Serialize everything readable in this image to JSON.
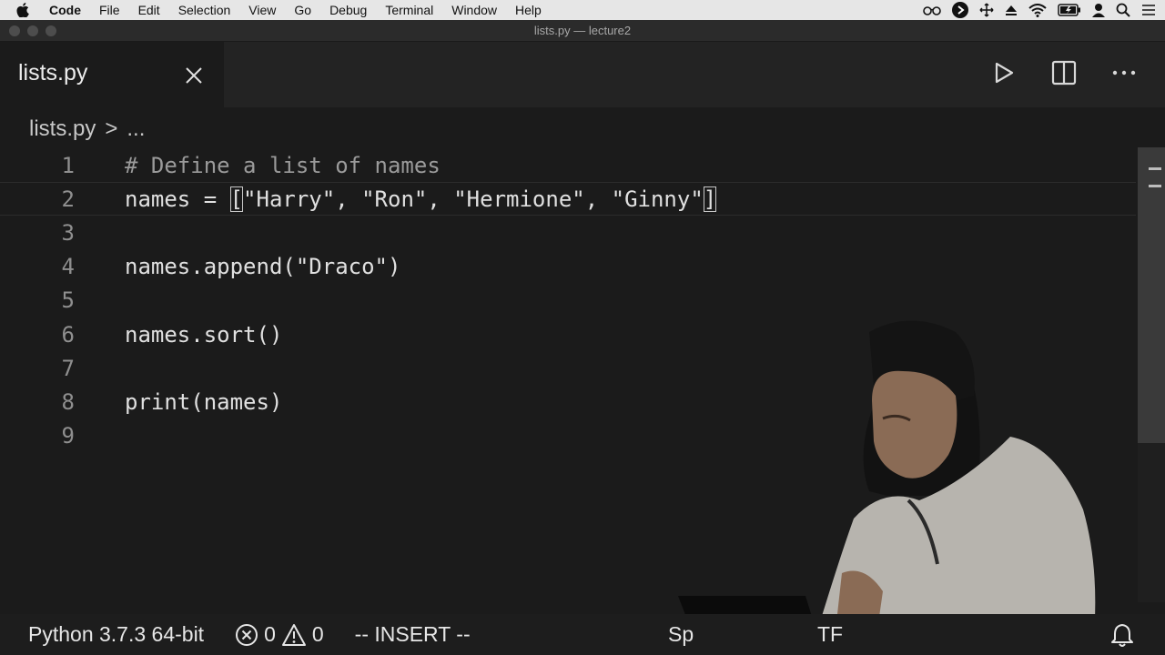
{
  "menubar": {
    "app_name": "Code",
    "items": [
      "File",
      "Edit",
      "Selection",
      "View",
      "Go",
      "Debug",
      "Terminal",
      "Window",
      "Help"
    ],
    "tray_icons": [
      "glasses-icon",
      "forward-circle-icon",
      "move-icon",
      "eject-icon",
      "wifi-icon",
      "battery-icon",
      "user-icon",
      "search-icon",
      "list-icon"
    ]
  },
  "window": {
    "title": "lists.py — lecture2"
  },
  "tab": {
    "label": "lists.py"
  },
  "breadcrumb": {
    "file": "lists.py",
    "separator": ">",
    "more": "..."
  },
  "editor": {
    "lines": [
      {
        "number": "1",
        "text": "# Define a list of names"
      },
      {
        "number": "2",
        "text": "names = ",
        "bracket_open": "[",
        "middle": "\"Harry\", \"Ron\", \"Hermione\", \"Ginny\"",
        "bracket_close": "]"
      },
      {
        "number": "3",
        "text": ""
      },
      {
        "number": "4",
        "text": "names.append(\"Draco\")"
      },
      {
        "number": "5",
        "text": ""
      },
      {
        "number": "6",
        "text": "names.sort()"
      },
      {
        "number": "7",
        "text": ""
      },
      {
        "number": "8",
        "text": "print(names)"
      },
      {
        "number": "9",
        "text": ""
      }
    ]
  },
  "statusbar": {
    "interpreter": "Python 3.7.3 64-bit",
    "errors": "0",
    "warnings": "0",
    "mode": "-- INSERT --",
    "spaces_partial": "Sp",
    "encoding_partial": "TF"
  },
  "colors": {
    "editor_bg": "#1b1b1b",
    "menubar_bg": "#e6e6e6",
    "line_number": "#8f8f8f"
  }
}
